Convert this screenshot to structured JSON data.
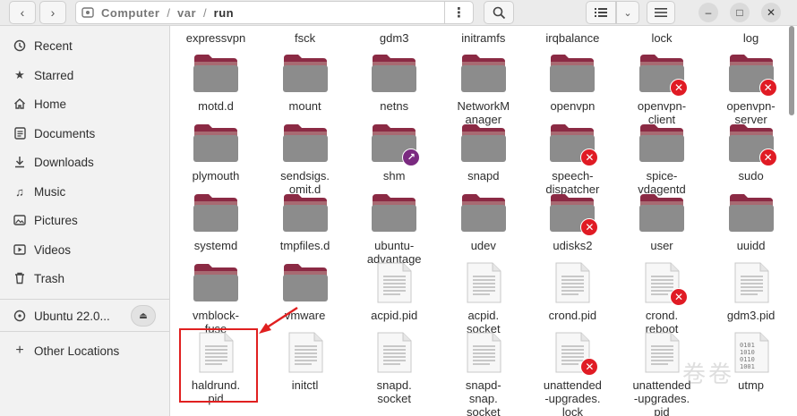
{
  "path": {
    "root": "Computer",
    "segments": [
      "var",
      "run"
    ]
  },
  "sidebar": {
    "items": [
      {
        "label": "Recent",
        "icon": "clock-icon"
      },
      {
        "label": "Starred",
        "icon": "star-icon"
      },
      {
        "label": "Home",
        "icon": "home-icon"
      },
      {
        "label": "Documents",
        "icon": "document-icon"
      },
      {
        "label": "Downloads",
        "icon": "download-icon"
      },
      {
        "label": "Music",
        "icon": "music-icon"
      },
      {
        "label": "Pictures",
        "icon": "picture-icon"
      },
      {
        "label": "Videos",
        "icon": "video-icon"
      },
      {
        "label": "Trash",
        "icon": "trash-icon"
      }
    ],
    "volume": {
      "label": "Ubuntu 22.0...",
      "icon": "disc-icon"
    },
    "other": {
      "label": "Other Locations",
      "icon": "plus-icon"
    }
  },
  "top_labels": [
    "expressvpn",
    "fsck",
    "gdm3",
    "initramfs",
    "irqbalance",
    "lock",
    "log"
  ],
  "files": [
    {
      "label": "motd.d",
      "kind": "folder",
      "emblem": ""
    },
    {
      "label": "mount",
      "kind": "folder",
      "emblem": ""
    },
    {
      "label": "netns",
      "kind": "folder",
      "emblem": ""
    },
    {
      "label": "NetworkM\nanager",
      "kind": "folder",
      "emblem": ""
    },
    {
      "label": "openvpn",
      "kind": "folder",
      "emblem": ""
    },
    {
      "label": "openvpn-\nclient",
      "kind": "folder",
      "emblem": "x"
    },
    {
      "label": "openvpn-\nserver",
      "kind": "folder",
      "emblem": "x"
    },
    {
      "label": "plymouth",
      "kind": "folder",
      "emblem": ""
    },
    {
      "label": "sendsigs.\nomit.d",
      "kind": "folder",
      "emblem": ""
    },
    {
      "label": "shm",
      "kind": "folder",
      "emblem": "link"
    },
    {
      "label": "snapd",
      "kind": "folder",
      "emblem": ""
    },
    {
      "label": "speech-\ndispatcher",
      "kind": "folder",
      "emblem": "x"
    },
    {
      "label": "spice-\nvdagentd",
      "kind": "folder",
      "emblem": ""
    },
    {
      "label": "sudo",
      "kind": "folder",
      "emblem": "x"
    },
    {
      "label": "systemd",
      "kind": "folder",
      "emblem": ""
    },
    {
      "label": "tmpfiles.d",
      "kind": "folder",
      "emblem": ""
    },
    {
      "label": "ubuntu-\nadvantage",
      "kind": "folder",
      "emblem": ""
    },
    {
      "label": "udev",
      "kind": "folder",
      "emblem": ""
    },
    {
      "label": "udisks2",
      "kind": "folder",
      "emblem": "x"
    },
    {
      "label": "user",
      "kind": "folder",
      "emblem": ""
    },
    {
      "label": "uuidd",
      "kind": "folder",
      "emblem": ""
    },
    {
      "label": "vmblock-\nfuse",
      "kind": "folder",
      "emblem": ""
    },
    {
      "label": "vmware",
      "kind": "folder",
      "emblem": ""
    },
    {
      "label": "acpid.pid",
      "kind": "file",
      "emblem": ""
    },
    {
      "label": "acpid.\nsocket",
      "kind": "file",
      "emblem": ""
    },
    {
      "label": "crond.pid",
      "kind": "file",
      "emblem": ""
    },
    {
      "label": "crond.\nreboot",
      "kind": "file",
      "emblem": "x"
    },
    {
      "label": "gdm3.pid",
      "kind": "file",
      "emblem": ""
    },
    {
      "label": "haldrund.\npid",
      "kind": "file",
      "emblem": ""
    },
    {
      "label": "initctl",
      "kind": "file",
      "emblem": ""
    },
    {
      "label": "snapd.\nsocket",
      "kind": "file",
      "emblem": ""
    },
    {
      "label": "snapd-\nsnap.\nsocket",
      "kind": "file",
      "emblem": ""
    },
    {
      "label": "unattended\n-upgrades.\nlock",
      "kind": "file",
      "emblem": "x"
    },
    {
      "label": "unattended\n-upgrades.\npid",
      "kind": "file",
      "emblem": ""
    },
    {
      "label": "utmp",
      "kind": "binary",
      "emblem": ""
    }
  ],
  "colors": {
    "folder_top": "#8b2a44",
    "folder_body": "#a86a72",
    "folder_front": "#8c8c8c",
    "emblem_error": "#e01b24",
    "emblem_link": "#7a2a80",
    "highlight": "#e02020"
  },
  "watermark": "卷卷"
}
